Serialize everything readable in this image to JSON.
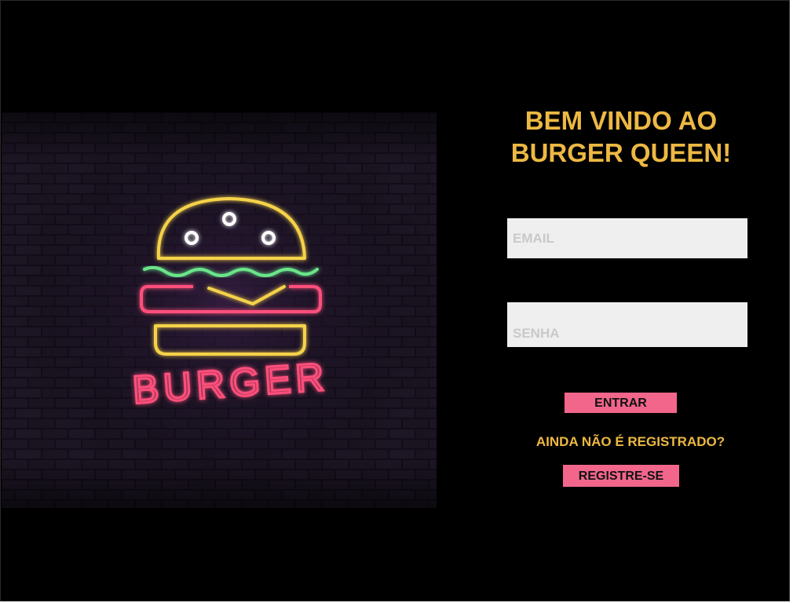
{
  "hero": {
    "sign_text": "BURGER"
  },
  "welcome": {
    "line1": "BEM VINDO AO",
    "line2": "BURGER QUEEN!"
  },
  "login": {
    "email_placeholder": "EMAIL",
    "password_placeholder": "SENHA",
    "enter_label": "ENTRAR",
    "not_registered_text": "AINDA NÃO É REGISTRADO?",
    "register_label": "REGISTRE-SE"
  },
  "colors": {
    "background": "#000000",
    "title_yellow": "#EDB943",
    "button_pink": "#F2668B",
    "input_bg": "#EFEFEF",
    "neon_yellow": "#F5D24A",
    "neon_green": "#6BE58A",
    "neon_pink": "#FF4F7B"
  }
}
